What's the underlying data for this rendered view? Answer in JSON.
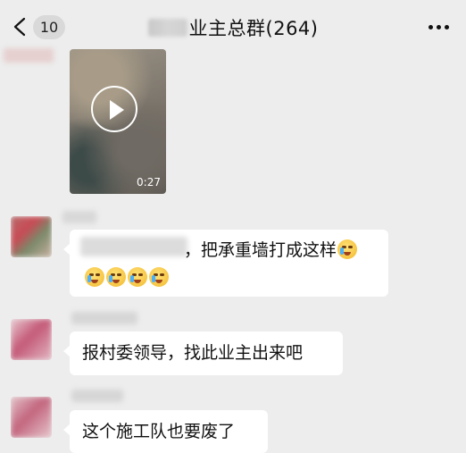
{
  "nav": {
    "unread_count": "10",
    "title": "业主总群(264)",
    "back_icon": "chevron-left-icon",
    "more_icon": "more-dots-icon"
  },
  "video_message": {
    "duration": "0:27",
    "play_icon": "play-icon"
  },
  "messages": [
    {
      "text": "，把承重墙打成这样",
      "emoji": "crying-face-emoji"
    },
    {
      "text": "报村委领导，找此业主出来吧"
    },
    {
      "text": "这个施工队也要废了"
    }
  ],
  "colors": {
    "background": "#ededed",
    "bubble": "#ffffff",
    "badge": "#d9d9d9"
  }
}
